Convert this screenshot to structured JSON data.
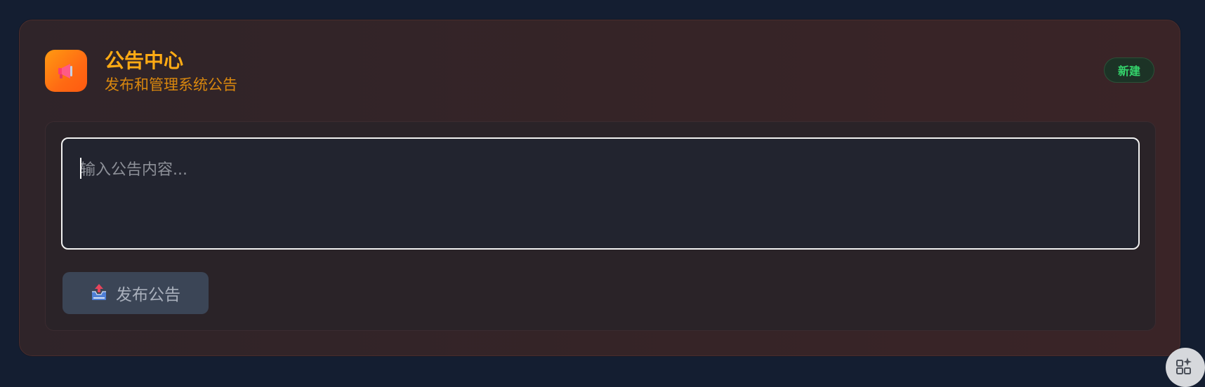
{
  "header": {
    "icon": "megaphone-icon",
    "title": "公告中心",
    "subtitle": "发布和管理系统公告",
    "badge": "新建"
  },
  "editor": {
    "placeholder": "输入公告内容...",
    "value": ""
  },
  "publish": {
    "icon": "outbox-tray-icon",
    "label": "发布公告"
  },
  "floating": {
    "icon": "apps-sparkle-icon"
  },
  "colors": {
    "accent": "#ffab14",
    "badge_text": "#34d36b",
    "button_bg": "#3b4556",
    "page_bg": "#141e31"
  }
}
